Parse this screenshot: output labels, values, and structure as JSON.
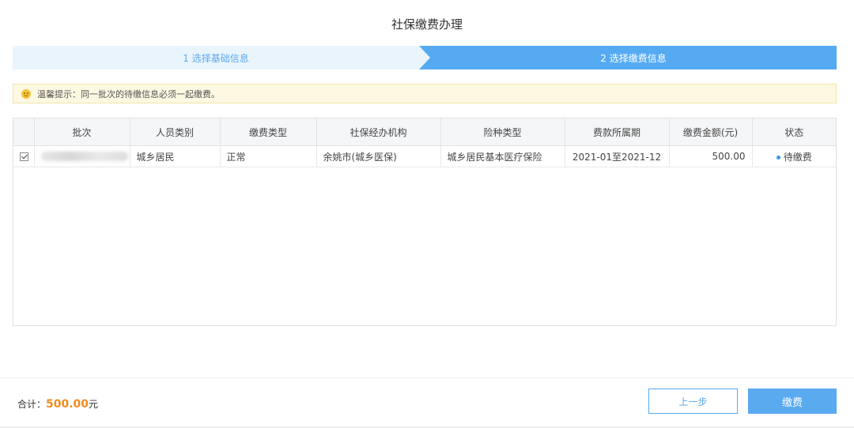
{
  "page": {
    "title": "社保缴费办理"
  },
  "steps": [
    {
      "label": "1 选择基础信息"
    },
    {
      "label": "2 选择缴费信息"
    }
  ],
  "tip": {
    "text": "温馨提示：同一批次的待缴信息必须一起缴费。"
  },
  "table": {
    "headers": [
      "批次",
      "人员类别",
      "缴费类型",
      "社保经办机构",
      "险种类型",
      "费款所属期",
      "缴费金额(元)",
      "状态"
    ],
    "rows": [
      {
        "checked": true,
        "batch": "",
        "person_type": "城乡居民",
        "pay_type": "正常",
        "agency": "余姚市(城乡医保)",
        "insurance": "城乡居民基本医疗保险",
        "period": "2021-01至2021-12",
        "amount": "500.00",
        "status": "待缴费"
      }
    ]
  },
  "footer": {
    "total_label": "合计：",
    "total_amount": "500.00",
    "total_unit": "元",
    "prev_label": "上一步",
    "pay_label": "缴费"
  },
  "colors": {
    "accent": "#55aaf2",
    "step_inactive_bg": "#eaf4fd",
    "tip_bg": "#fdf8e2",
    "amount": "#f08c1e",
    "status_dot": "#3a95ee"
  }
}
